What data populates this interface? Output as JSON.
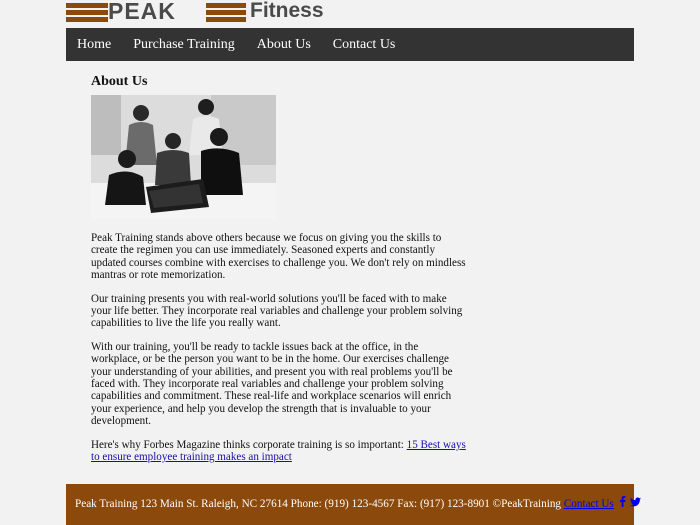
{
  "brand": {
    "word1": "PEAK",
    "word2": "Fitness"
  },
  "nav": [
    {
      "label": "Home"
    },
    {
      "label": "Purchase Training"
    },
    {
      "label": "About Us"
    },
    {
      "label": "Contact Us"
    }
  ],
  "page": {
    "heading": "About Us",
    "paragraphs": [
      "Peak Training stands above others because we focus on giving you the skills to create the regimen you can use immediately. Seasoned experts and constantly updated courses combine with exercises to challenge you. We don't rely on mindless mantras or rote memorization.",
      "Our training presents you with real-world solutions you'll be faced with to make your life better. They incorporate real variables and challenge your problem solving capabilities to live the life you really want.",
      "With our training, you'll be ready to tackle issues back at the office, in the workplace, or be the person you want to be in the home. Our exercises challenge your understanding of your abilities, and present you with real problems you'll be faced with. They incorporate real variables and challenge your problem solving capabilities and commitment. These real-life and workplace scenarios will enrich your experience, and help you develop the strength that is invaluable to your development."
    ],
    "forbes_text": "Here's why Forbes Magazine thinks corporate training is so important: ",
    "forbes_link": "15 Best ways to ensure employee training makes an impact"
  },
  "footer": {
    "text": "Peak Training 123 Main St. Raleigh, NC 27614 Phone: (919) 123-4567 Fax: (917) 123-8901 ©PeakTraining ",
    "contact_link": "Contact Us"
  },
  "colors": {
    "brand_brown": "#8b4a0c",
    "nav_bg": "#333333"
  },
  "icons": [
    "facebook-icon",
    "twitter-icon"
  ]
}
